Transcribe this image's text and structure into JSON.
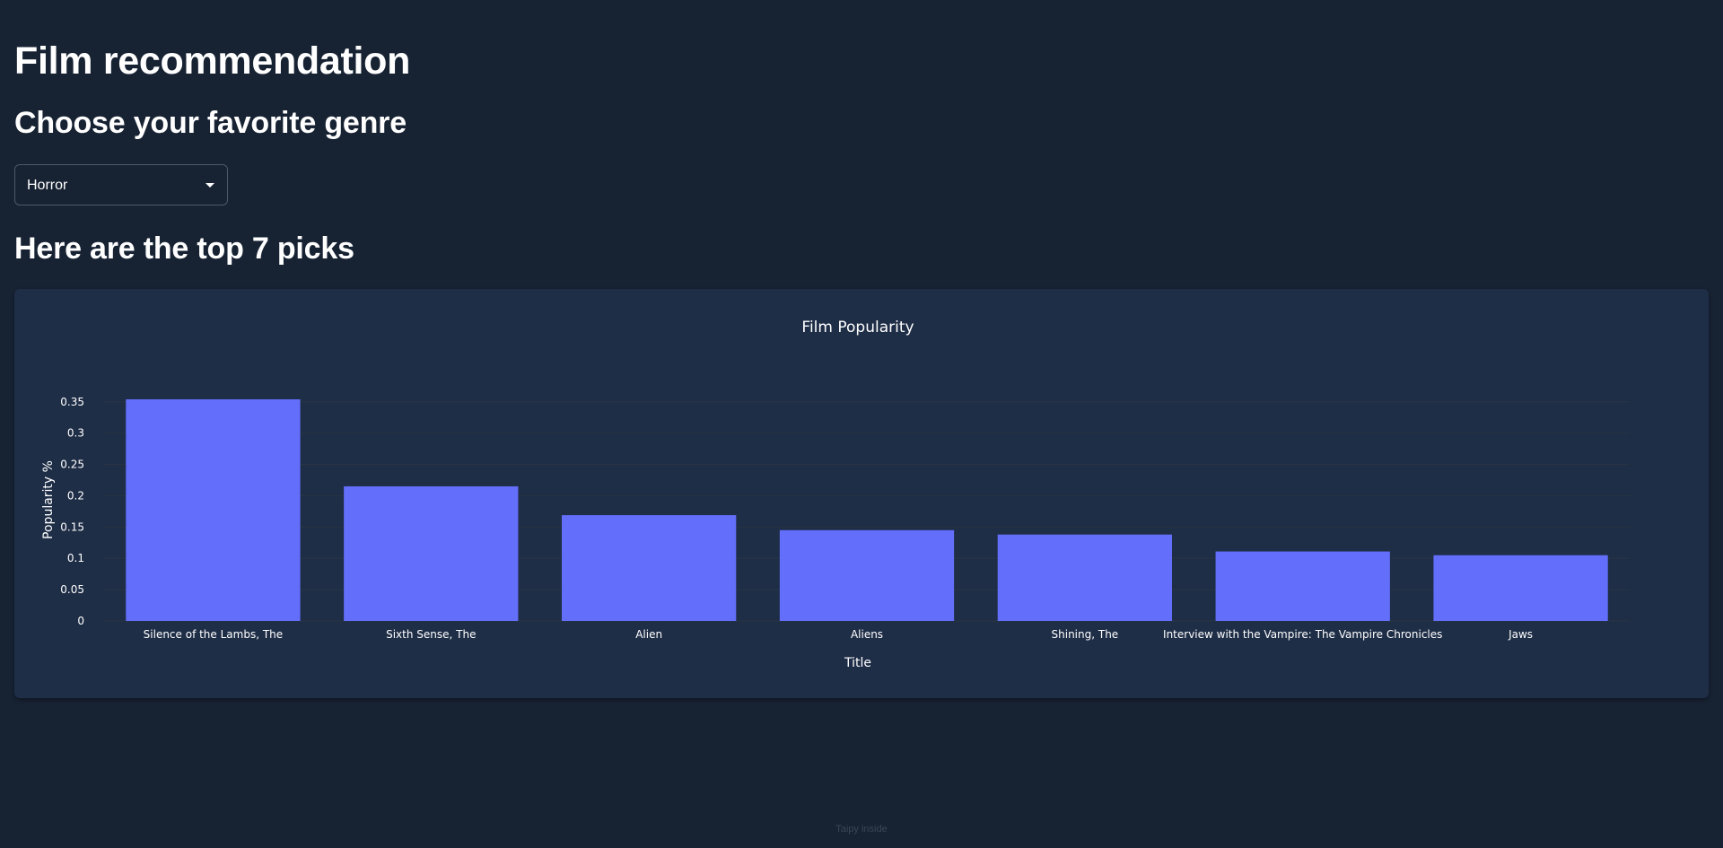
{
  "page": {
    "title": "Film recommendation",
    "genre_heading": "Choose your favorite genre",
    "picks_heading": "Here are the top 7 picks",
    "footer": "Taipy inside"
  },
  "genre_select": {
    "value": "Horror"
  },
  "colors": {
    "background": "#172233",
    "card": "#1f2e47",
    "bar": "#636efa",
    "grid": "#283442",
    "text": "#ffffff"
  },
  "chart_data": {
    "type": "bar",
    "title": "Film Popularity",
    "xlabel": "Title",
    "ylabel": "Popularity %",
    "categories": [
      "Silence of the Lambs, The",
      "Sixth Sense, The",
      "Alien",
      "Aliens",
      "Shining, The",
      "Interview with the Vampire: The Vampire Chronicles",
      "Jaws"
    ],
    "values": [
      0.354,
      0.215,
      0.169,
      0.145,
      0.138,
      0.111,
      0.105
    ],
    "yticks": [
      "0",
      "0.05",
      "0.1",
      "0.15",
      "0.2",
      "0.25",
      "0.3",
      "0.35"
    ],
    "ytick_values": [
      0,
      0.05,
      0.1,
      0.15,
      0.2,
      0.25,
      0.3,
      0.35
    ],
    "ylim": [
      0,
      0.3726
    ],
    "grid": true
  }
}
